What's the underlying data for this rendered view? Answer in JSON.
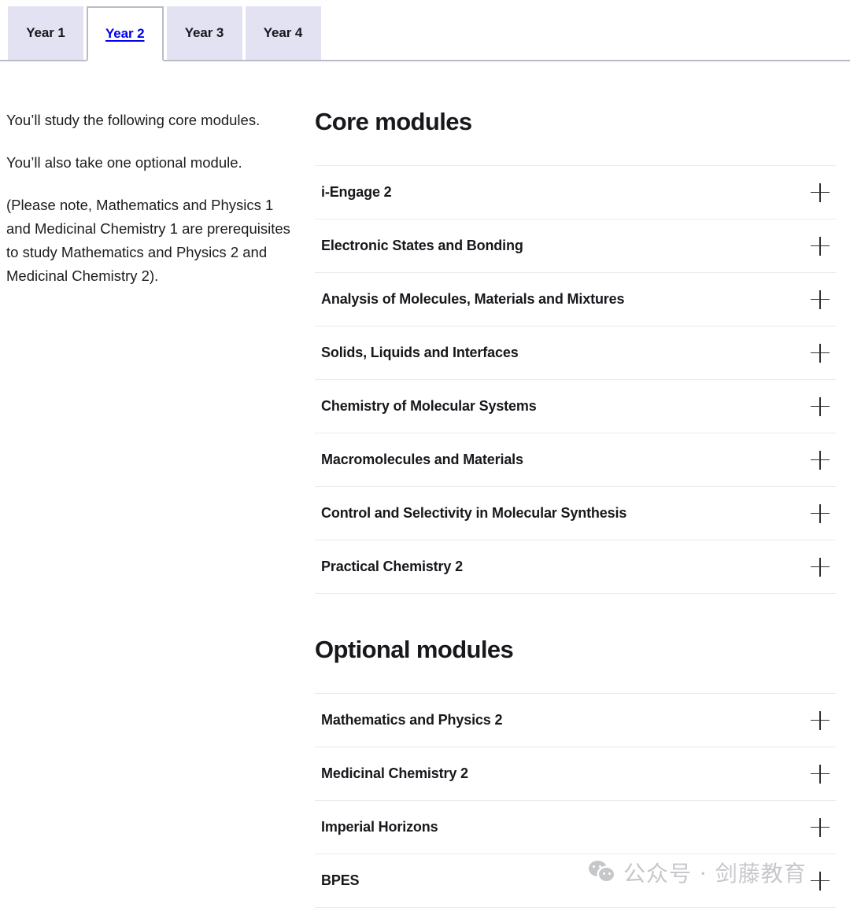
{
  "tabs": [
    {
      "label": "Year 1",
      "active": false
    },
    {
      "label": "Year 2",
      "active": true
    },
    {
      "label": "Year 3",
      "active": false
    },
    {
      "label": "Year 4",
      "active": false
    }
  ],
  "intro": {
    "paragraphs": [
      "You’ll study the following core modules.",
      "You’ll also take one optional module.",
      "(Please note, Mathematics and Physics 1 and Medicinal Chemistry 1 are prerequisites to study Mathematics and Physics 2 and Medicinal Chemistry 2)."
    ]
  },
  "core": {
    "title": "Core modules",
    "modules": [
      "i-Engage 2",
      "Electronic States and Bonding",
      "Analysis of Molecules, Materials and Mixtures",
      "Solids, Liquids and Interfaces",
      "Chemistry of Molecular Systems",
      "Macromolecules and Materials",
      "Control and Selectivity in Molecular Synthesis",
      "Practical Chemistry 2"
    ]
  },
  "optional": {
    "title": "Optional modules",
    "modules": [
      "Mathematics and Physics 2",
      "Medicinal Chemistry 2",
      "Imperial Horizons",
      "BPES"
    ]
  },
  "icons": {
    "expand": "plus-icon"
  },
  "watermark": {
    "text": "公众号 · 剑藤教育",
    "logo": "wechat-icon"
  },
  "colors": {
    "tab_inactive_bg": "#e3e2f3",
    "tab_active_link": "#0000ee",
    "tab_border": "#b9bcc6",
    "divider": "#e8eaed",
    "text": "#17181c",
    "watermark": "#c6c7ca"
  }
}
